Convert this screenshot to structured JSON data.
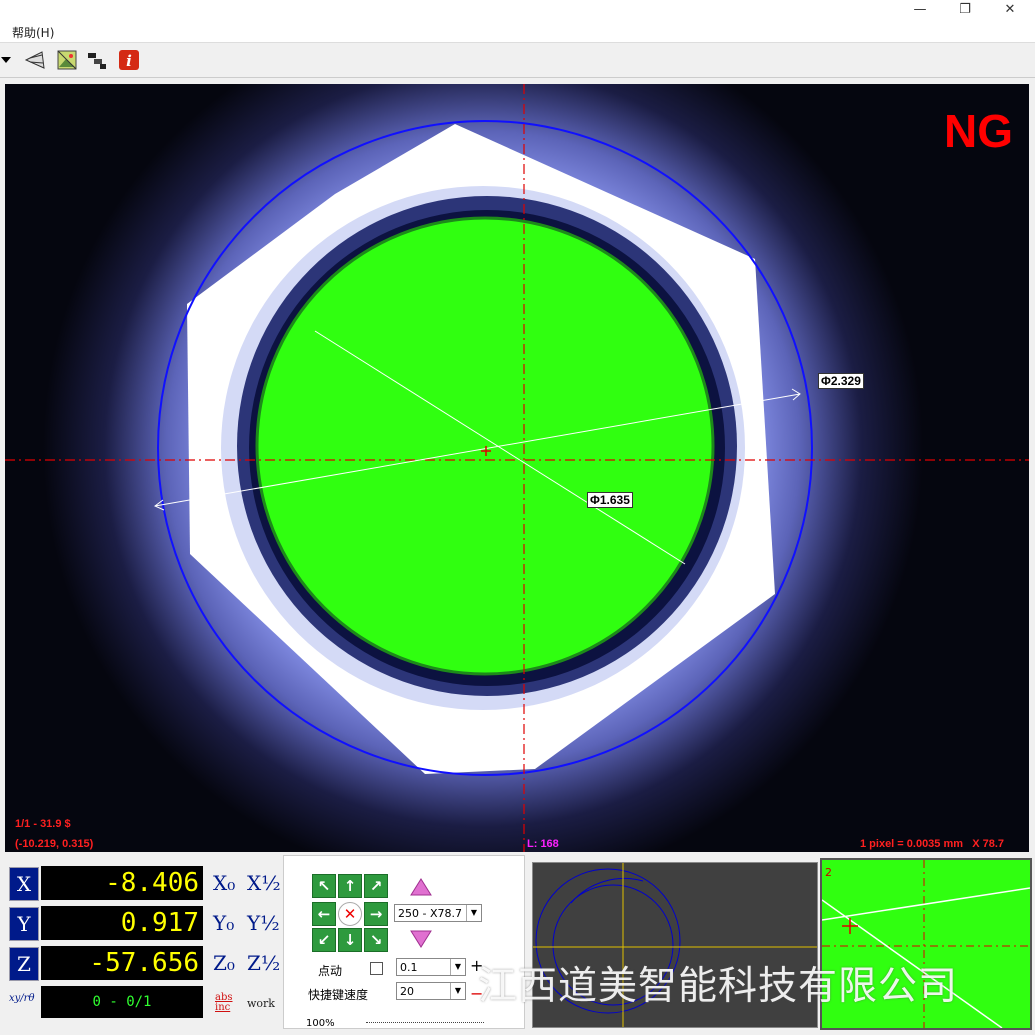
{
  "window": {
    "minimize": "—",
    "restore": "❐",
    "close": "✕"
  },
  "menu": {
    "help": "帮助(H)"
  },
  "toolbar": {
    "icons": [
      "dropdown-arrow-icon",
      "measure-tool-icon",
      "image-icon",
      "step-icon",
      "info-icon"
    ]
  },
  "viewer": {
    "status": "NG",
    "frame_info": "1/1 - 31.9 $",
    "cursor_coords": "(-10.219, 0.315)",
    "length_readout": "L: 168",
    "scale_readout": "1 pixel = 0.0035 mm   X 78.7",
    "outer_diameter": "Φ2.329",
    "inner_diameter": "Φ1.635"
  },
  "dro": {
    "x_label": "X",
    "x_value": "-8.406",
    "y_label": "Y",
    "y_value": "0.917",
    "z_label": "Z",
    "z_value": "-57.656",
    "x_zero": "X₀",
    "x_half": "X½",
    "y_zero": "Y₀",
    "y_half": "Y½",
    "z_zero": "Z₀",
    "z_half": "Z½",
    "mode_label": "xy/rθ",
    "counter": "0 - 0/1",
    "abs_label": "abs",
    "inc_label": "inc",
    "work_label": "work"
  },
  "controls": {
    "zoom_select": "250 - X78.7",
    "jog_label": "点动",
    "jog_value": "0.1",
    "speed_label": "快捷键速度",
    "speed_value": "20",
    "plus": "+",
    "minus": "−",
    "light_percent": "100%"
  },
  "minimap2": {
    "index": "2"
  },
  "watermark": "江西道美智能科技有限公司",
  "colors": {
    "ng": "#ff0000",
    "fill": "#30ff10",
    "circle": "#0000ff",
    "crosshair": "#ff0000",
    "dro_bg": "#001a8a",
    "dro_text": "#ffff00"
  }
}
